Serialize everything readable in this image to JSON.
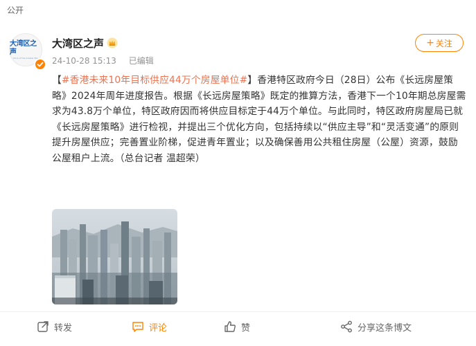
{
  "top": {
    "visibility": "公开"
  },
  "post": {
    "author": {
      "name": "大湾区之声",
      "avatar_text": "大湾区之声",
      "avatar_subtext": "Voice of the Greater Bay"
    },
    "timestamp": "24-10-28 15:13",
    "edited": "已编辑",
    "follow_label": "关注",
    "content": {
      "bracket_open": "【",
      "hashtag": "#香港未来10年目标供应44万个房屋单位#",
      "bracket_close": "】",
      "body": "香港特区政府今日（28日）公布《长远房屋策略》2024年周年进度报告。根据《长远房屋策略》既定的推算方法，香港下一个10年期总房屋需求为43.8万个单位，特区政府因而将供应目标定于44万个单位。与此同时，特区政府房屋局已就《长远房屋策略》进行检视，并提出三个优化方向，包括持续以“供应主导”和“灵活变通”的原则提升房屋供应；完善置业阶梯，促进青年置业；以及确保善用公共租住房屋（公屋）资源，鼓励公屋租户上流。（总台记者 温超荣）"
    }
  },
  "actions": {
    "repost": "转发",
    "comment": "评论",
    "like": "赞",
    "share": "分享这条博文"
  },
  "colors": {
    "accent": "#ff8200",
    "hashtag": "#eb7350"
  }
}
